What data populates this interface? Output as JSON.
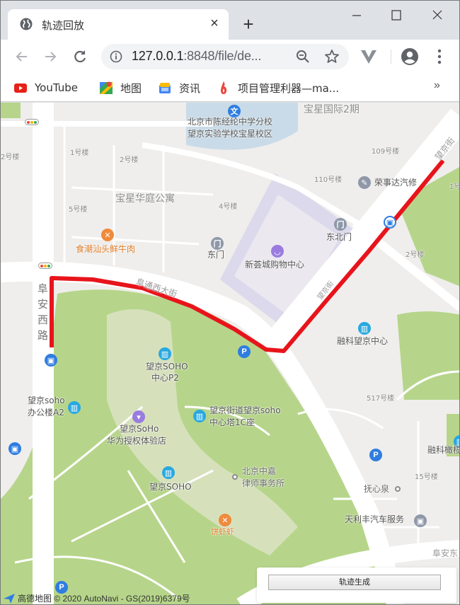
{
  "browser": {
    "tab_title": "轨迹回放",
    "tab_close_label": "×",
    "new_tab_label": "+",
    "url_host": "127.0.0.1",
    "url_rest": ":8848/file/de...",
    "bookmarks": [
      {
        "label": "YouTube",
        "icon": "youtube-icon"
      },
      {
        "label": "地图",
        "icon": "maps-icon"
      },
      {
        "label": "资讯",
        "icon": "news-icon"
      },
      {
        "label": "项目管理利器—ma...",
        "icon": "flame-icon"
      }
    ],
    "bookmarks_more": "»"
  },
  "map": {
    "labels": {
      "school1": "北京市陈经纶中学分校",
      "school2": "望京实验学校宝星校区",
      "baoxing2": "宝星国际2期",
      "b109": "109号楼",
      "b110": "110号楼",
      "rongshida": "荣事达汽修",
      "b1_left": "1号楼",
      "b2_left": "2号楼",
      "b2_edge": "2号楼",
      "b5": "5号楼",
      "b4": "4号楼",
      "baoxing_huating": "宝星华庭公寓",
      "restaurant": "食潮汕头鲜牛肉",
      "east_gate": "东门",
      "northeast_gate": "东北门",
      "mall": "新荟城购物中心",
      "b1_right": "1号",
      "b2_right": "2号楼",
      "road_futong": "阜通西大街",
      "road_fuan_west": "阜安西路",
      "road_wangjing": "望京街",
      "road_fuxi": "望京街",
      "road_top_right": "望京街",
      "rongke": "融科望京中心",
      "soho_p2_1": "望京SOHO",
      "soho_p2_2": "中心P2",
      "soho_a2_1": "望京soho",
      "soho_a2_2": "办公楼A2",
      "huawei_1": "望京SoHo",
      "huawei_2": "华为授权体验店",
      "tower1c_1": "望京街道望京soho",
      "tower1c_2": "中心塔1C座",
      "soho": "望京SOHO",
      "lawfirm_1": "北京中嘉",
      "lawfirm_2": "律师事务所",
      "b517": "517号楼",
      "rongke_right": "融科橄榄",
      "b15": "15号楼",
      "fuxinquan": "抚心泉",
      "tianlifeng": "天利丰汽车服务",
      "shrimp": "饼虾虾",
      "fuan_east": "阜安东"
    },
    "attribution": "高德地图 © 2020 AutoNavi - GS(2019)6379号",
    "route_color": "#e8141b",
    "generate_button": "轨迹生成"
  }
}
